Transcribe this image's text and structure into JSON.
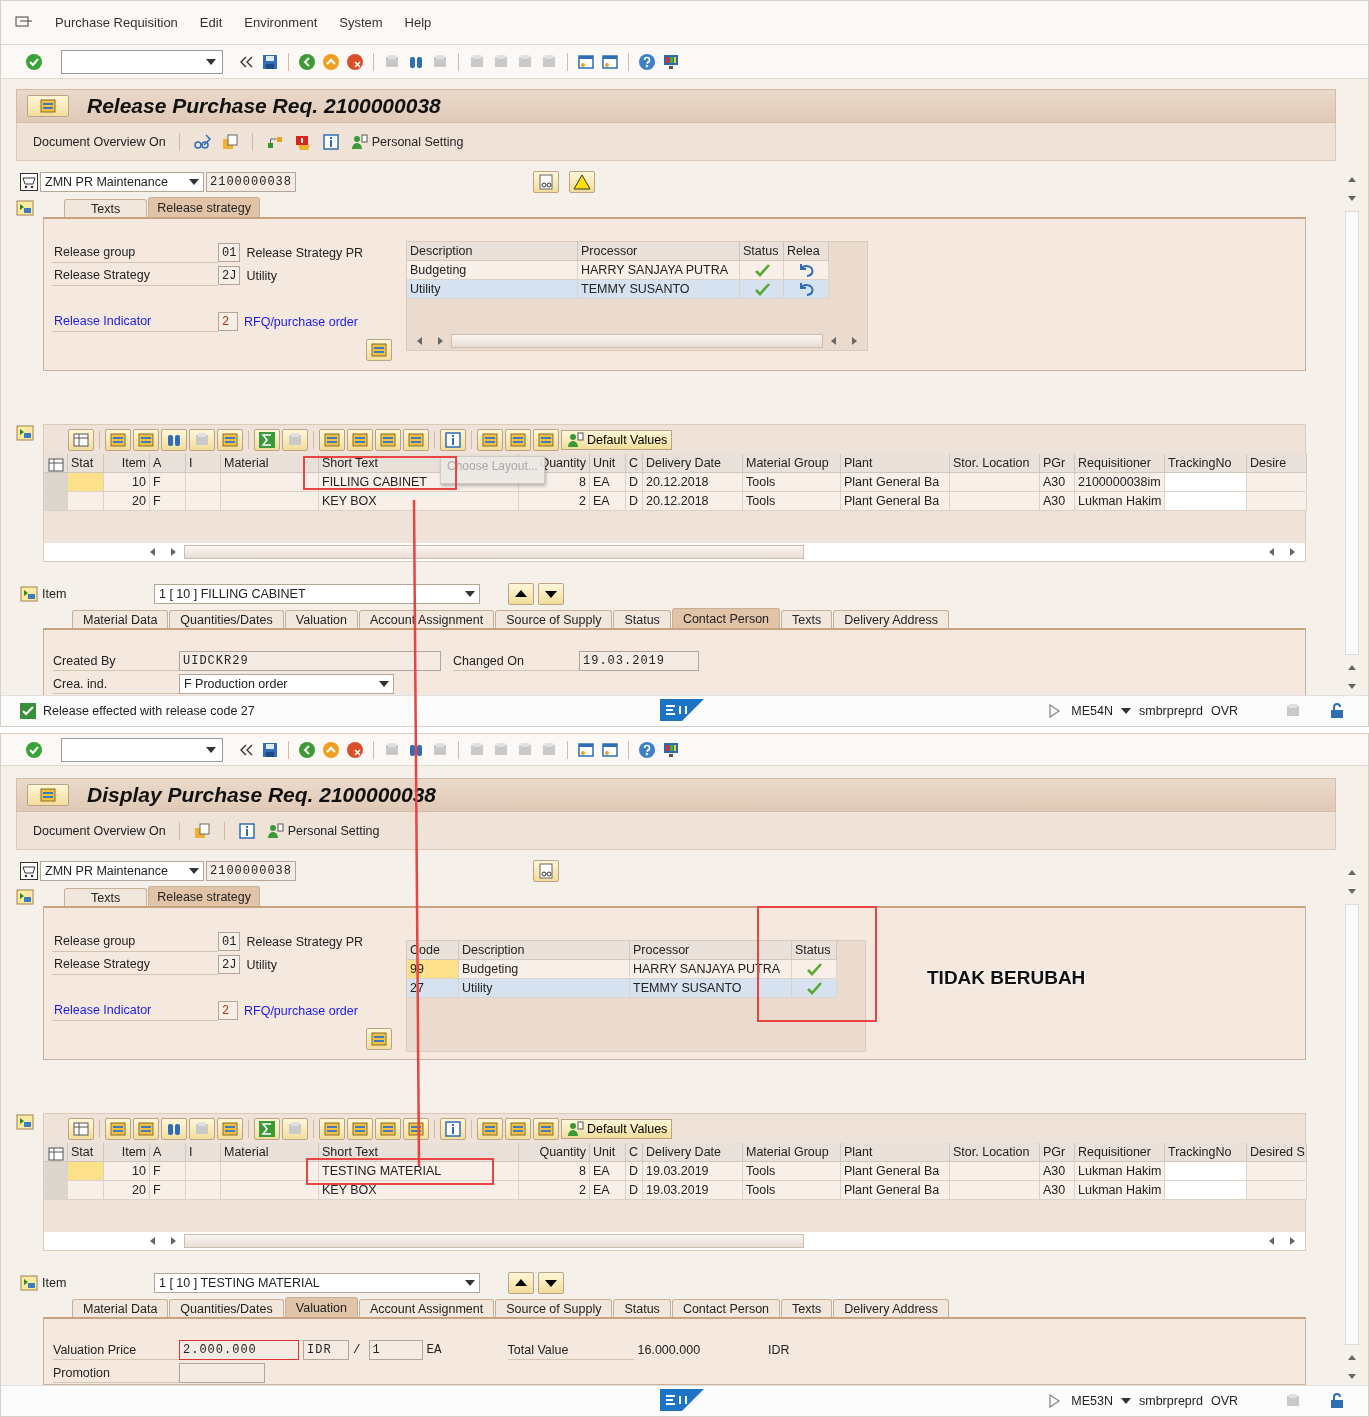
{
  "menu": [
    "Purchase Requisition",
    "Edit",
    "Environment",
    "System",
    "Help"
  ],
  "screens": [
    {
      "kind": "release",
      "title": "Release Purchase Req. 2100000038",
      "app_toolbar": {
        "overview": "Document Overview On",
        "personal": "Personal Setting"
      },
      "doc_type": "ZMN PR Maintenance",
      "doc_number": "2100000038",
      "header_tabs": [
        {
          "label": "Texts",
          "selected": false
        },
        {
          "label": "Release strategy",
          "selected": true
        }
      ],
      "release_fields": [
        {
          "label": "Release group",
          "code": "01",
          "text": "Release Strategy PR",
          "link": false
        },
        {
          "label": "Release Strategy",
          "code": "2J",
          "text": "Utility",
          "link": false
        },
        {
          "label": "Release Indicator",
          "code": "2",
          "text": "RFQ/purchase order",
          "link": true
        }
      ],
      "approvals": {
        "columns": [
          "Description",
          "Processor",
          "Status",
          "Relea"
        ],
        "rows": [
          {
            "cells": [
              "Budgeting",
              "HARRY SANJAYA PUTRA"
            ],
            "released": true,
            "current": false,
            "selected": false
          },
          {
            "cells": [
              "Utility",
              "TEMMY SUSANTO"
            ],
            "released": true,
            "current": false,
            "selected": true
          }
        ]
      },
      "items": {
        "tooltip": "Choose Layout...",
        "default_values": "Default Values",
        "columns": [
          "Stat",
          "Item",
          "A",
          "I",
          "Material",
          "Short Text",
          "Quantity",
          "Unit",
          "C",
          "Delivery Date",
          "Material Group",
          "Plant",
          "Stor. Location",
          "PGr",
          "Requisitioner",
          "TrackingNo",
          "Desire"
        ],
        "rows": [
          {
            "cells": [
              null,
              "10",
              "F",
              null,
              null,
              "FILLING CABINET",
              "8",
              "EA",
              "D",
              "20.12.2018",
              "Tools",
              "Plant General Ba",
              null,
              "A30",
              "2100000038im",
              null,
              null
            ],
            "current": true
          },
          {
            "cells": [
              null,
              "20",
              "F",
              null,
              null,
              "KEY BOX",
              "2",
              "EA",
              "D",
              "20.12.2018",
              "Tools",
              "Plant General Ba",
              null,
              "A30",
              "Lukman Hakim",
              null,
              null
            ],
            "current": false
          }
        ]
      },
      "item_selector": {
        "label": "Item",
        "value": "1 [ 10 ] FILLING CABINET"
      },
      "item_tabs": [
        {
          "label": "Material Data",
          "selected": false
        },
        {
          "label": "Quantities/Dates",
          "selected": false
        },
        {
          "label": "Valuation",
          "selected": false
        },
        {
          "label": "Account Assignment",
          "selected": false
        },
        {
          "label": "Source of Supply",
          "selected": false
        },
        {
          "label": "Status",
          "selected": false
        },
        {
          "label": "Contact Person",
          "selected": true
        },
        {
          "label": "Texts",
          "selected": false
        },
        {
          "label": "Delivery Address",
          "selected": false
        }
      ],
      "detail_rows": [
        [
          {
            "kind": "label",
            "text": "Created By"
          },
          {
            "kind": "field",
            "value": "UIDCKR29",
            "error": false
          },
          {
            "kind": "label",
            "text": "Changed On"
          },
          {
            "kind": "field",
            "value": "19.03.2019",
            "error": false
          }
        ],
        [
          {
            "kind": "label",
            "text": "Crea. ind."
          },
          {
            "kind": "dropdown",
            "value": "F Production order"
          }
        ]
      ],
      "status_bar": {
        "message": "Release effected with release code 27",
        "transaction": "ME54N",
        "system": "smbrpreprd",
        "mode": "OVR"
      }
    },
    {
      "kind": "display",
      "title": "Display Purchase Req. 2100000038",
      "app_toolbar": {
        "overview": "Document Overview On",
        "personal": "Personal Setting"
      },
      "doc_type": "ZMN PR Maintenance",
      "doc_number": "2100000038",
      "header_tabs": [
        {
          "label": "Texts",
          "selected": false
        },
        {
          "label": "Release strategy",
          "selected": true
        }
      ],
      "release_fields": [
        {
          "label": "Release group",
          "code": "01",
          "text": "Release Strategy PR",
          "link": false
        },
        {
          "label": "Release Strategy",
          "code": "2J",
          "text": "Utility",
          "link": false
        },
        {
          "label": "Release Indicator",
          "code": "2",
          "text": "RFQ/purchase order",
          "link": true
        }
      ],
      "approvals": {
        "columns": [
          "Code",
          "Description",
          "Processor",
          "Status"
        ],
        "rows": [
          {
            "cells": [
              "99",
              "Budgeting",
              "HARRY SANJAYA PUTRA"
            ],
            "released": true,
            "current": true,
            "selected": false
          },
          {
            "cells": [
              "27",
              "Utility",
              "TEMMY SUSANTO"
            ],
            "released": true,
            "current": false,
            "selected": true
          }
        ]
      },
      "items": {
        "default_values": "Default Values",
        "columns": [
          "Stat",
          "Item",
          "A",
          "I",
          "Material",
          "Short Text",
          "Quantity",
          "Unit",
          "C",
          "Delivery Date",
          "Material Group",
          "Plant",
          "Stor. Location",
          "PGr",
          "Requisitioner",
          "TrackingNo",
          "Desired S"
        ],
        "rows": [
          {
            "cells": [
              null,
              "10",
              "F",
              null,
              null,
              "TESTING MATERIAL",
              "8",
              "EA",
              "D",
              "19.03.2019",
              "Tools",
              "Plant General Ba",
              null,
              "A30",
              "Lukman Hakim",
              null,
              null
            ],
            "current": true
          },
          {
            "cells": [
              null,
              "20",
              "F",
              null,
              null,
              "KEY BOX",
              "2",
              "EA",
              "D",
              "19.03.2019",
              "Tools",
              "Plant General Ba",
              null,
              "A30",
              "Lukman Hakim",
              null,
              null
            ],
            "current": false
          }
        ]
      },
      "item_selector": {
        "label": "Item",
        "value": "1 [ 10 ] TESTING MATERIAL"
      },
      "item_tabs": [
        {
          "label": "Material Data",
          "selected": false
        },
        {
          "label": "Quantities/Dates",
          "selected": false
        },
        {
          "label": "Valuation",
          "selected": true
        },
        {
          "label": "Account Assignment",
          "selected": false
        },
        {
          "label": "Source of Supply",
          "selected": false
        },
        {
          "label": "Status",
          "selected": false
        },
        {
          "label": "Contact Person",
          "selected": false
        },
        {
          "label": "Texts",
          "selected": false
        },
        {
          "label": "Delivery Address",
          "selected": false
        }
      ],
      "detail_rows": [
        [
          {
            "kind": "label",
            "text": "Valuation Price"
          },
          {
            "kind": "field",
            "value": "2.000.000",
            "error": true
          },
          {
            "kind": "field",
            "value": "IDR",
            "error": false
          },
          {
            "kind": "text",
            "text": "/"
          },
          {
            "kind": "field",
            "value": "1",
            "error": false
          },
          {
            "kind": "text",
            "text": "EA"
          },
          {
            "kind": "label",
            "text": "Total Value"
          },
          {
            "kind": "text",
            "text": "16.000.000"
          },
          {
            "kind": "text",
            "text": "IDR"
          }
        ],
        [
          {
            "kind": "label",
            "text": "Promotion"
          },
          {
            "kind": "field",
            "error": false
          }
        ]
      ],
      "status_bar": {
        "transaction": "ME53N",
        "system": "smbrpreprd",
        "mode": "OVR"
      }
    }
  ],
  "annotation": {
    "label": "TIDAK BERUBAH"
  }
}
